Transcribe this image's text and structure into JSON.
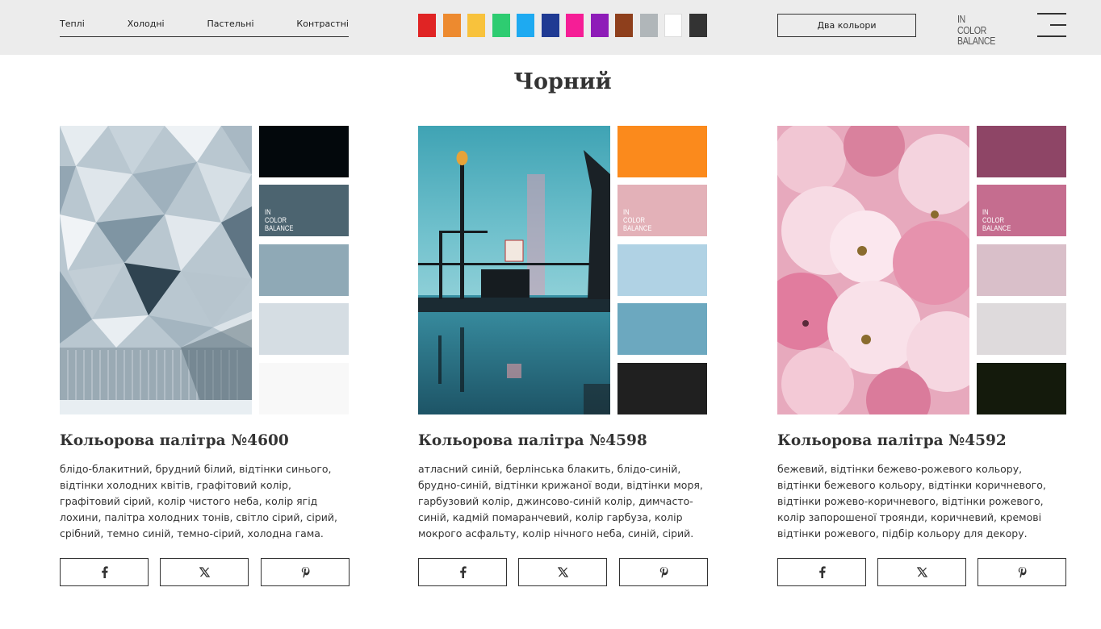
{
  "header": {
    "nav": [
      {
        "label": "Теплі"
      },
      {
        "label": "Холодні"
      },
      {
        "label": "Пастельні"
      },
      {
        "label": "Контрастні"
      }
    ],
    "color_filters": [
      {
        "name": "red",
        "color": "#e02424"
      },
      {
        "name": "orange",
        "color": "#ed8a2f"
      },
      {
        "name": "yellow",
        "color": "#f8c23c"
      },
      {
        "name": "green",
        "color": "#2ecc71"
      },
      {
        "name": "light-blue",
        "color": "#1eaaf1"
      },
      {
        "name": "blue",
        "color": "#1f3a93"
      },
      {
        "name": "pink",
        "color": "#f51e96"
      },
      {
        "name": "purple",
        "color": "#8e1cb8"
      },
      {
        "name": "brown",
        "color": "#8e3f1c"
      },
      {
        "name": "gray",
        "color": "#b0b6b9"
      },
      {
        "name": "white",
        "color": "#ffffff"
      },
      {
        "name": "black",
        "color": "#333333"
      }
    ],
    "two_colors_button": "Два кольори",
    "logo_line1": "IN COLOR",
    "logo_line2": "BALANCE",
    "menu_icon": "hamburger-icon"
  },
  "page_title": "Чорний",
  "cards": [
    {
      "title": "Кольорова палітра №4600",
      "description": "блідо-блакитний, брудний білий, відтінки синього, відтінки холодних квітів, графітовий колір, графітовий сірий, колір чистого неба, колір ягід лохини, палітра холодних тонів, світло сірий, сірий, срібний, темно синій, темно-сірий, холодна гама.",
      "palette": [
        "#03080c",
        "#4c6470",
        "#8fa9b6",
        "#d5dde3",
        "#f8f8f8"
      ],
      "logo": [
        "IN",
        "COLOR",
        "BALANCE"
      ]
    },
    {
      "title": "Кольорова палітра №4598",
      "description": "атласний синій, берлінська блакить, блідо-синій, брудно-синій, відтінки крижаної води, відтінки моря, гарбузовий колір, джинсово-синій колір, димчасто-синій, кадмій помаранчевий, колір гарбуза, колір мокрого асфальту, колір нічного неба, синій, сірий.",
      "palette": [
        "#fb8a1c",
        "#e3b1b8",
        "#b0d2e4",
        "#6ca8bf",
        "#202020"
      ],
      "logo": [
        "IN",
        "COLOR",
        "BALANCE"
      ]
    },
    {
      "title": "Кольорова палітра №4592",
      "description": "бежевий, відтінки бежево-рожевого кольору, відтінки бежевого кольору, відтінки коричневого, відтінки рожево-коричневого, відтінки рожевого, колір запорошеної троянди, коричневий, кремові відтінки рожевого, підбір кольору для декору.",
      "palette": [
        "#8e4566",
        "#c56d8f",
        "#d9bfc9",
        "#dedadc",
        "#141a0c"
      ],
      "logo": [
        "IN",
        "COLOR",
        "BALANCE"
      ]
    }
  ],
  "share_icons": [
    "facebook-icon",
    "x-icon",
    "pinterest-icon"
  ]
}
